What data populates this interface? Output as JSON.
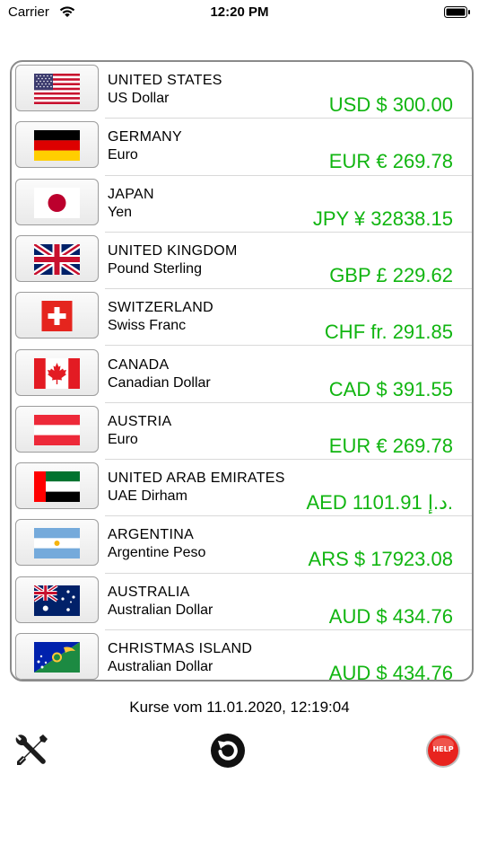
{
  "status_bar": {
    "carrier": "Carrier",
    "time": "12:20 PM"
  },
  "rows": [
    {
      "country": "UNITED STATES",
      "currency": "US Dollar",
      "amount": "USD $  300.00",
      "flag": "us-flag"
    },
    {
      "country": "GERMANY",
      "currency": "Euro",
      "amount": "EUR €  269.78",
      "flag": "germany-flag"
    },
    {
      "country": "JAPAN",
      "currency": "Yen",
      "amount": "JPY ¥  32838.15",
      "flag": "japan-flag"
    },
    {
      "country": "UNITED KINGDOM",
      "currency": "Pound Sterling",
      "amount": "GBP £  229.62",
      "flag": "uk-flag"
    },
    {
      "country": "SWITZERLAND",
      "currency": "Swiss Franc",
      "amount": "CHF fr.  291.85",
      "flag": "switzerland-flag"
    },
    {
      "country": "CANADA",
      "currency": "Canadian Dollar",
      "amount": "CAD $  391.55",
      "flag": "canada-flag"
    },
    {
      "country": "AUSTRIA",
      "currency": "Euro",
      "amount": "EUR €  269.78",
      "flag": "austria-flag"
    },
    {
      "country": "UNITED ARAB EMIRATES",
      "currency": "UAE Dirham",
      "amount": "AED 1101.91  د.إ.",
      "flag": "uae-flag"
    },
    {
      "country": "ARGENTINA",
      "currency": "Argentine Peso",
      "amount": "ARS $  17923.08",
      "flag": "argentina-flag"
    },
    {
      "country": "AUSTRALIA",
      "currency": "Australian Dollar",
      "amount": "AUD $  434.76",
      "flag": "australia-flag"
    },
    {
      "country": "CHRISTMAS ISLAND",
      "currency": "Australian Dollar",
      "amount": "AUD $  434.76",
      "flag": "christmas-island-flag"
    }
  ],
  "timestamp": "Kurse vom 11.01.2020, 12:19:04",
  "toolbar": {
    "settings_icon": "tools-icon",
    "refresh_icon": "refresh-icon",
    "help_label": "HELP"
  },
  "colors": {
    "amount": "#11b511",
    "frame": "#8a8a8a",
    "help_red": "#e8231e"
  }
}
